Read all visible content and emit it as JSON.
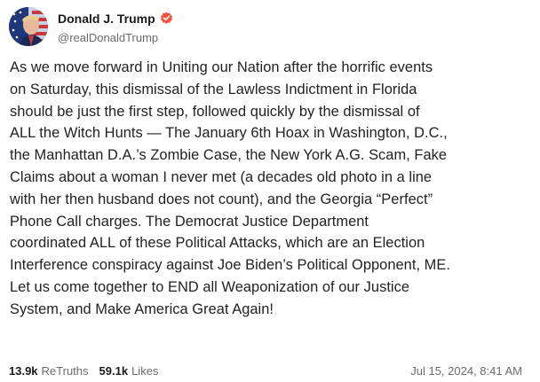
{
  "post": {
    "author": {
      "display_name": "Donald J. Trump",
      "handle": "@realDonaldTrump",
      "verified": true,
      "verified_color": "#f2553b"
    },
    "body_lines": [
      "As we move forward in Uniting our Nation after the horrific events",
      "on Saturday, this dismissal of the Lawless Indictment in Florida",
      "should be just the first step, followed quickly by the dismissal of",
      "ALL the Witch Hunts — The January 6th Hoax in Washington, D.C.,",
      "the Manhattan D.A.’s Zombie Case, the New York A.G. Scam, Fake",
      "Claims about a woman I never met (a decades old photo in a line",
      "with her then husband does not count), and the Georgia “Perfect”",
      "Phone Call charges. The Democrat Justice Department",
      "coordinated ALL of these Political Attacks, which are an Election",
      "Interference conspiracy against Joe Biden’s Political Opponent, ME.",
      "Let us come together to END all Weaponization of our Justice",
      "System, and Make America Great Again!"
    ],
    "stats": {
      "retruths_count": "13.9k",
      "retruths_label": "ReTruths",
      "likes_count": "59.1k",
      "likes_label": "Likes"
    },
    "timestamp": "Jul 15, 2024, 8:41 AM"
  }
}
